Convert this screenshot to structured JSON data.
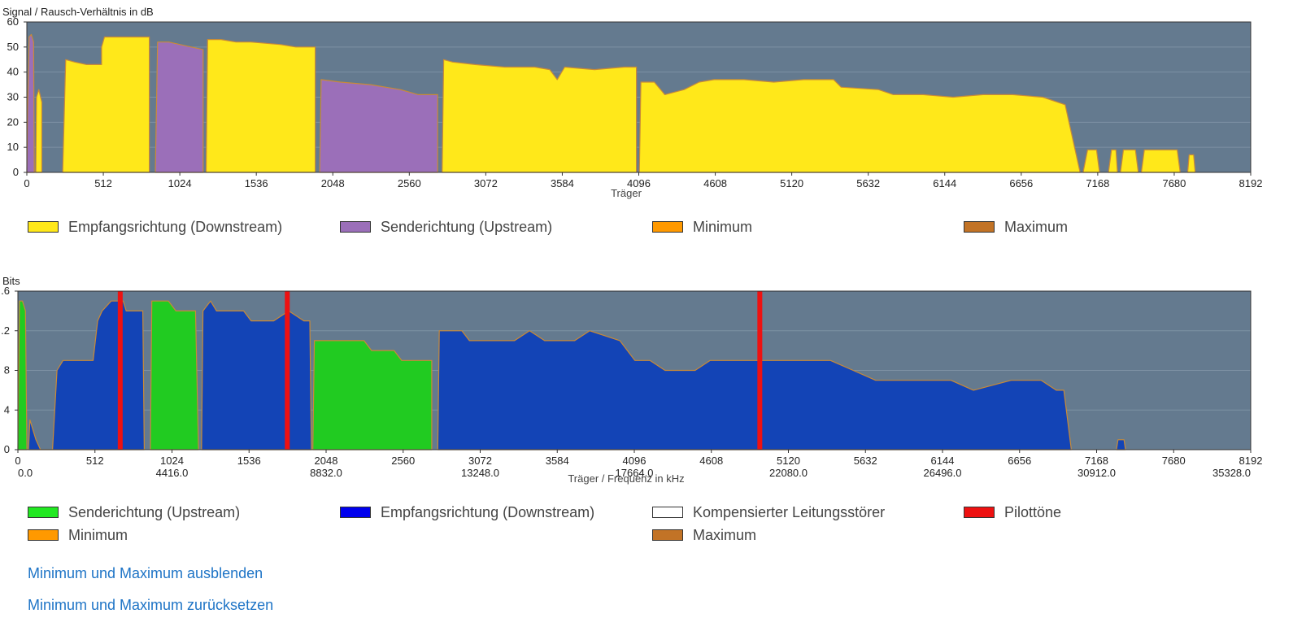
{
  "colors": {
    "plot_bg": "#647a8f",
    "downstream_snr": "#ffe81a",
    "upstream_snr": "#9b6fb9",
    "downstream_bits": "#1344b6",
    "upstream_bits": "#21cb21",
    "pilot": "#ee1111",
    "minimum": "#ff9900",
    "maximum": "#c27326",
    "line": "#c98a37",
    "link": "#1e74c6"
  },
  "chart_data": [
    {
      "type": "area",
      "ylabel": "Signal / Rausch-Verhältnis in dB",
      "xlabel": "Träger",
      "xlim": [
        0,
        8192
      ],
      "ylim": [
        0,
        60
      ],
      "xticks": [
        "0",
        "512",
        "1024",
        "1536",
        "2048",
        "2560",
        "3072",
        "3584",
        "4096",
        "4608",
        "5120",
        "5632",
        "6144",
        "6656",
        "7168",
        "7680",
        "8192"
      ],
      "yticks": [
        "0",
        "10",
        "20",
        "30",
        "40",
        "50",
        "60"
      ],
      "grid": true,
      "series": [
        {
          "name": "Empfangsrichtung (Downstream)",
          "segments": [
            [
              [
                60,
                0
              ],
              [
                65,
                30
              ],
              [
                80,
                33
              ],
              [
                100,
                28
              ],
              [
                100,
                0
              ]
            ],
            [
              [
                240,
                0
              ],
              [
                260,
                45
              ],
              [
                320,
                44
              ],
              [
                400,
                43
              ],
              [
                500,
                43
              ],
              [
                500,
                50
              ],
              [
                520,
                54
              ],
              [
                700,
                54
              ],
              [
                820,
                54
              ],
              [
                820,
                0
              ]
            ],
            [
              [
                1200,
                0
              ],
              [
                1210,
                53
              ],
              [
                1300,
                53
              ],
              [
                1400,
                52
              ],
              [
                1500,
                52
              ],
              [
                1700,
                51
              ],
              [
                1800,
                50
              ],
              [
                1930,
                50
              ],
              [
                1930,
                0
              ]
            ],
            [
              [
                2780,
                0
              ],
              [
                2790,
                45
              ],
              [
                2850,
                44
              ],
              [
                3000,
                43
              ],
              [
                3200,
                42
              ],
              [
                3400,
                42
              ],
              [
                3500,
                41
              ],
              [
                3550,
                37
              ],
              [
                3600,
                42
              ],
              [
                3800,
                41
              ],
              [
                4000,
                42
              ],
              [
                4080,
                42
              ],
              [
                4080,
                0
              ]
            ],
            [
              [
                4100,
                0
              ],
              [
                4110,
                36
              ],
              [
                4200,
                36
              ],
              [
                4270,
                31
              ],
              [
                4400,
                33
              ],
              [
                4500,
                36
              ],
              [
                4600,
                37
              ],
              [
                4800,
                37
              ],
              [
                5000,
                36
              ],
              [
                5200,
                37
              ],
              [
                5400,
                37
              ],
              [
                5450,
                34
              ],
              [
                5700,
                33
              ],
              [
                5800,
                31
              ],
              [
                6000,
                31
              ],
              [
                6200,
                30
              ],
              [
                6400,
                31
              ],
              [
                6600,
                31
              ],
              [
                6800,
                30
              ],
              [
                6950,
                27
              ],
              [
                7050,
                0
              ]
            ],
            [
              [
                7070,
                0
              ],
              [
                7100,
                9
              ],
              [
                7160,
                9
              ],
              [
                7180,
                0
              ]
            ],
            [
              [
                7240,
                0
              ],
              [
                7260,
                9
              ],
              [
                7290,
                9
              ],
              [
                7300,
                0
              ]
            ],
            [
              [
                7320,
                0
              ],
              [
                7340,
                9
              ],
              [
                7420,
                9
              ],
              [
                7440,
                0
              ]
            ],
            [
              [
                7460,
                0
              ],
              [
                7480,
                9
              ],
              [
                7700,
                9
              ],
              [
                7720,
                0
              ]
            ],
            [
              [
                7770,
                0
              ],
              [
                7780,
                7
              ],
              [
                7810,
                7
              ],
              [
                7820,
                0
              ]
            ]
          ]
        },
        {
          "name": "Senderichtung (Upstream)",
          "segments": [
            [
              [
                0,
                0
              ],
              [
                5,
                25
              ],
              [
                15,
                54
              ],
              [
                30,
                55
              ],
              [
                45,
                52
              ],
              [
                50,
                0
              ]
            ],
            [
              [
                860,
                0
              ],
              [
                875,
                52
              ],
              [
                950,
                52
              ],
              [
                1100,
                50
              ],
              [
                1180,
                49
              ],
              [
                1180,
                0
              ]
            ],
            [
              [
                1960,
                0
              ],
              [
                1970,
                37
              ],
              [
                2100,
                36
              ],
              [
                2300,
                35
              ],
              [
                2500,
                33
              ],
              [
                2620,
                31
              ],
              [
                2750,
                31
              ],
              [
                2750,
                0
              ]
            ]
          ]
        }
      ],
      "legend": [
        "Empfangsrichtung (Downstream)",
        "Senderichtung (Upstream)",
        "Minimum",
        "Maximum"
      ]
    },
    {
      "type": "area",
      "ylabel": "Bits",
      "xlabel": "Träger / Frequenz in kHz",
      "xlim": [
        0,
        8192
      ],
      "ylim": [
        0,
        16
      ],
      "xticks": [
        "0",
        "512",
        "1024",
        "1536",
        "2048",
        "2560",
        "3072",
        "3584",
        "4096",
        "4608",
        "5120",
        "5632",
        "6144",
        "6656",
        "7168",
        "7680",
        "8192"
      ],
      "xticks2": [
        "0.0",
        "4416.0",
        "8832.0",
        "13248.0",
        "17664.0",
        "22080.0",
        "26496.0",
        "30912.0",
        "35328.0"
      ],
      "yticks": [
        "0",
        "4",
        "8",
        ".2",
        ".6"
      ],
      "grid": true,
      "series": [
        {
          "name": "Senderichtung (Upstream)",
          "segments": [
            [
              [
                0,
                0
              ],
              [
                10,
                15
              ],
              [
                30,
                15
              ],
              [
                50,
                14
              ],
              [
                60,
                0
              ]
            ],
            [
              [
                880,
                0
              ],
              [
                890,
                15
              ],
              [
                1000,
                15
              ],
              [
                1050,
                14
              ],
              [
                1180,
                14
              ],
              [
                1200,
                0
              ]
            ],
            [
              [
                1960,
                0
              ],
              [
                1970,
                11
              ],
              [
                2300,
                11
              ],
              [
                2350,
                10
              ],
              [
                2500,
                10
              ],
              [
                2550,
                9
              ],
              [
                2750,
                9
              ],
              [
                2750,
                0
              ]
            ]
          ]
        },
        {
          "name": "Empfangsrichtung (Downstream)",
          "segments": [
            [
              [
                70,
                0
              ],
              [
                80,
                3
              ],
              [
                120,
                1
              ],
              [
                150,
                0
              ],
              [
                230,
                0
              ],
              [
                260,
                8
              ],
              [
                300,
                9
              ],
              [
                500,
                9
              ],
              [
                530,
                13
              ],
              [
                560,
                14
              ],
              [
                620,
                15
              ],
              [
                700,
                15
              ],
              [
                720,
                14
              ],
              [
                830,
                14
              ],
              [
                840,
                0
              ]
            ],
            [
              [
                1220,
                0
              ],
              [
                1230,
                14
              ],
              [
                1280,
                15
              ],
              [
                1320,
                14
              ],
              [
                1500,
                14
              ],
              [
                1550,
                13
              ],
              [
                1700,
                13
              ],
              [
                1800,
                14
              ],
              [
                1900,
                13
              ],
              [
                1940,
                13
              ],
              [
                1950,
                0
              ]
            ],
            [
              [
                2790,
                0
              ],
              [
                2800,
                12
              ],
              [
                2950,
                12
              ],
              [
                3000,
                11
              ],
              [
                3300,
                11
              ],
              [
                3400,
                12
              ],
              [
                3500,
                11
              ],
              [
                3700,
                11
              ],
              [
                3800,
                12
              ],
              [
                4000,
                11
              ],
              [
                4100,
                9
              ],
              [
                4200,
                9
              ],
              [
                4300,
                8
              ],
              [
                4500,
                8
              ],
              [
                4600,
                9
              ],
              [
                5000,
                9
              ],
              [
                5200,
                9
              ],
              [
                5400,
                9
              ],
              [
                5550,
                8
              ],
              [
                5700,
                7
              ],
              [
                6000,
                7
              ],
              [
                6200,
                7
              ],
              [
                6350,
                6
              ],
              [
                6600,
                7
              ],
              [
                6800,
                7
              ],
              [
                6900,
                6
              ],
              [
                6950,
                6
              ],
              [
                7000,
                0
              ]
            ],
            [
              [
                7300,
                0
              ],
              [
                7310,
                1
              ],
              [
                7350,
                1
              ],
              [
                7360,
                0
              ]
            ]
          ]
        }
      ],
      "pilots": [
        680,
        1790,
        4930
      ],
      "legend": [
        "Senderichtung (Upstream)",
        "Empfangsrichtung (Downstream)",
        "Kompensierter Leitungsstörer",
        "Pilottöne",
        "Minimum",
        "Maximum"
      ]
    }
  ],
  "links": {
    "hide_minmax": "Minimum und Maximum ausblenden",
    "reset_minmax": "Minimum und Maximum zurücksetzen"
  }
}
